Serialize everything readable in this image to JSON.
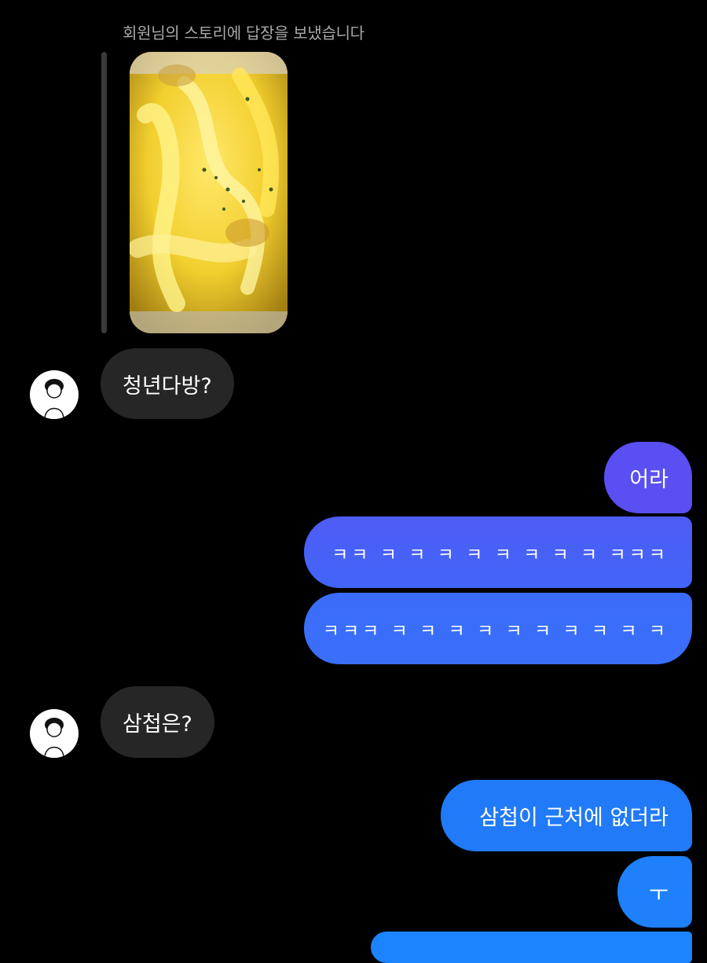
{
  "story_reply": {
    "caption": "회원님의 스토리에 답장을 보냈습니다",
    "image_desc": "cheese-fries-photo"
  },
  "messages": [
    {
      "side": "in",
      "text": "청년다방?"
    },
    {
      "side": "out",
      "text": "어라"
    },
    {
      "side": "out",
      "text": "ㅋㅋ ㅋ ㅋ ㅋ ㅋ ㅋ ㅋ ㅋ ㅋ  ㅋㅋㅋ"
    },
    {
      "side": "out",
      "text": "ㅋㅋㅋ ㅋ ㅋ ㅋ ㅋ ㅋ ㅋ ㅋ ㅋ ㅋ ㅋ"
    },
    {
      "side": "in",
      "text": "삼첩은?"
    },
    {
      "side": "out",
      "text": "삼첩이 근처에 없더라"
    },
    {
      "side": "out",
      "text": "ㅜ"
    }
  ],
  "colors": {
    "background": "#000000",
    "incoming_bubble": "#262626",
    "outgoing_gradient_top": "#5b4ff2",
    "outgoing_gradient_bottom": "#1e84ff"
  }
}
